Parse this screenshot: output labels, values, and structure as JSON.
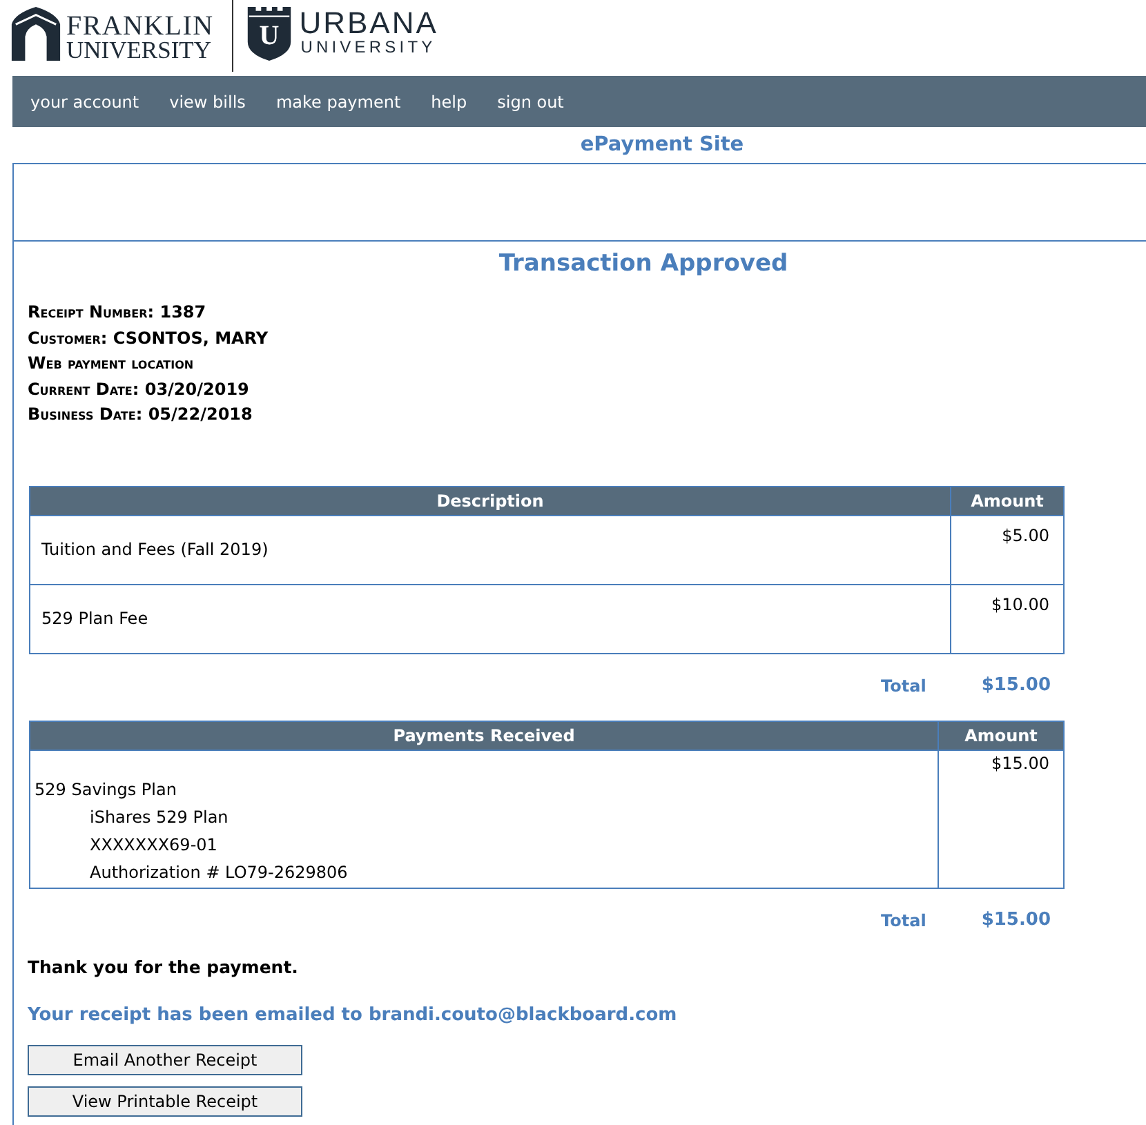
{
  "logos": [
    {
      "kind": "franklin",
      "name": "FRANKLIN",
      "subtitle": "UNIVERSITY"
    },
    {
      "kind": "urbana",
      "name": "URBANA",
      "subtitle": "UNIVERSITY",
      "emblem_letter": "U"
    }
  ],
  "nav": {
    "items": [
      "your account",
      "view bills",
      "make payment",
      "help",
      "sign out"
    ]
  },
  "site_title": "ePayment Site",
  "page_title": "Transaction Approved",
  "receipt_info": [
    "Receipt Number: 1387",
    "Customer: CSONTOS, MARY",
    "Web payment location",
    "Current Date: 03/20/2019",
    "Business Date: 05/22/2018"
  ],
  "charges_table": {
    "columns": [
      "Description",
      "Amount"
    ],
    "rows": [
      {
        "description": "Tuition and Fees (Fall 2019)",
        "amount": "$5.00"
      },
      {
        "description": "529 Plan Fee",
        "amount": "$10.00"
      }
    ],
    "total_label": "Total",
    "total": "$15.00"
  },
  "payments_table": {
    "columns": [
      "Payments Received",
      "Amount"
    ],
    "rows": [
      {
        "method": "529 Savings Plan",
        "details": [
          "iShares 529 Plan",
          "XXXXXXX69-01",
          "Authorization # LO79-2629806"
        ],
        "amount": "$15.00"
      }
    ],
    "total_label": "Total",
    "total": "$15.00"
  },
  "thank_you": "Thank you for the payment.",
  "email_notice": "Your receipt has been emailed to brandi.couto@blackboard.com",
  "buttons": [
    "Email Another Receipt",
    "View Printable Receipt"
  ]
}
